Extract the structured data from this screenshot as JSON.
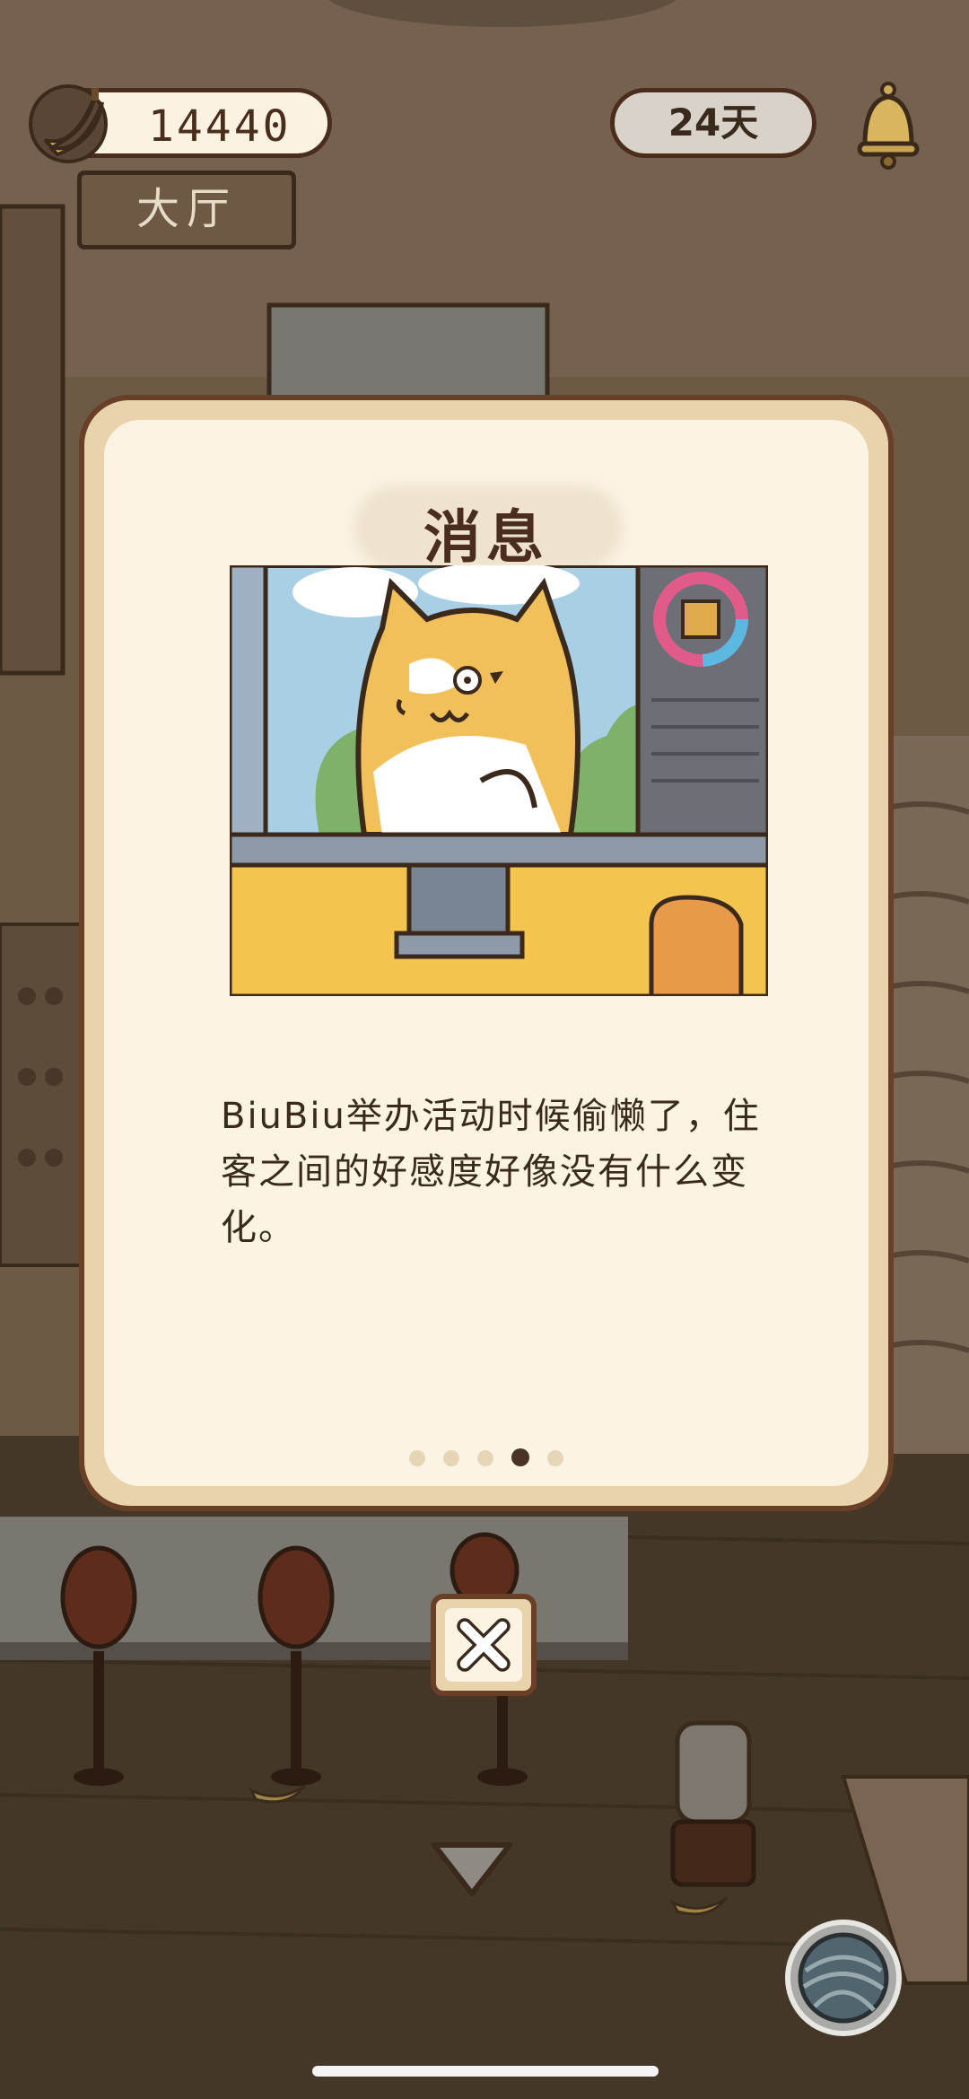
{
  "hud": {
    "coins": "14440",
    "days": "24天",
    "room": "大厅"
  },
  "dialog": {
    "title": "消息",
    "message": "BiuBiu举办活动时候偷懒了，住客之间的好感度好像没有什么变化。",
    "page_count": 5,
    "current_page": 4
  },
  "icons": {
    "currency": "banana-icon",
    "notifications": "bell-icon",
    "close": "close-icon",
    "scroll": "down-arrow-icon",
    "menu": "yarn-ball-icon"
  }
}
